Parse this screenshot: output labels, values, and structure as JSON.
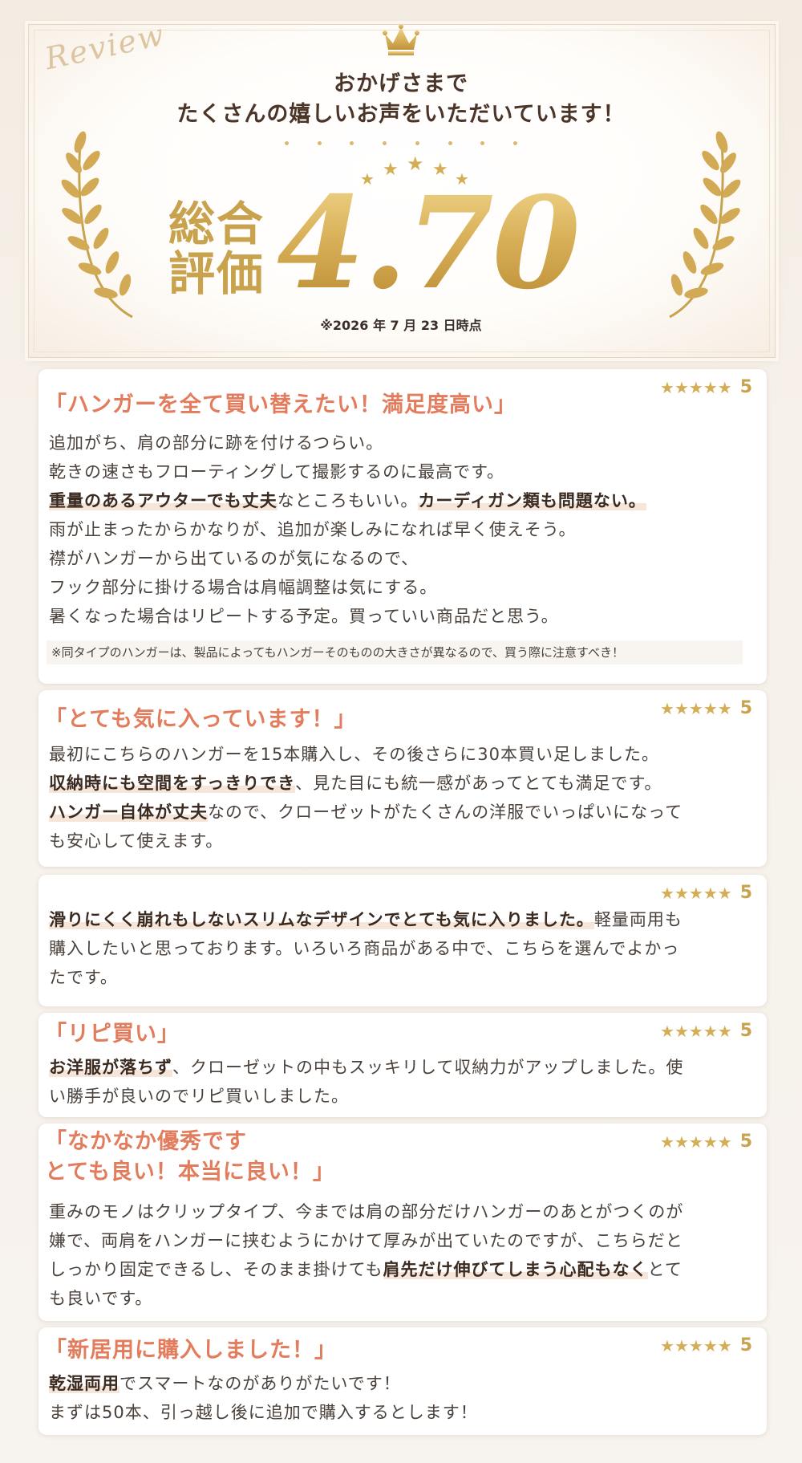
{
  "hero": {
    "script_word": "Review",
    "headline_line1": "おかげさまで",
    "headline_line2": "たくさんの嬉しいお声をいただいています！",
    "label_line1": "総合",
    "label_line2": "評価",
    "score": "4.70",
    "as_of": "※2026 年 7 月 23 日時点",
    "icons": [
      "crown-icon",
      "laurel-left-icon",
      "laurel-right-icon",
      "star-arc-icon"
    ],
    "gold_color": "#c9a24e"
  },
  "reviews": [
    {
      "stars": "★★★★★",
      "rating": "5",
      "title": "「ハンガーを全て買い替えたい！満足度高い」",
      "lines": [
        {
          "segs": [
            {
              "t": "追加がち、肩の部分に跡を付けるつらい。",
              "b": false
            }
          ]
        },
        {
          "segs": [
            {
              "t": "乾きの速さもフローティングして撮影するのに最高です。",
              "b": false
            }
          ]
        },
        {
          "segs": [
            {
              "t": "重量のあるアウターでも丈夫",
              "b": true
            },
            {
              "t": "なところもいい。",
              "b": false
            },
            {
              "t": "カーディガン類も問題ない。",
              "b": true
            }
          ]
        },
        {
          "segs": [
            {
              "t": "雨が止まったからかなりが、追加が楽しみになれば早く使えそう。",
              "b": false
            }
          ]
        },
        {
          "segs": [
            {
              "t": "襟がハンガーから出ているのが気になるので、",
              "b": false
            }
          ]
        },
        {
          "segs": [
            {
              "t": "フック部分に掛ける場合は肩幅調整は気にする。",
              "b": false
            }
          ]
        },
        {
          "segs": [
            {
              "t": "暑くなった場合はリピートする予定。買っていい商品だと思う。",
              "b": false
            }
          ]
        }
      ],
      "note": "※同タイプのハンガーは、製品によってもハンガーそのものの大きさが異なるので、買う際に注意すべき！"
    },
    {
      "stars": "★★★★★",
      "rating": "5",
      "title": "「とても気に入っています！」",
      "lines": [
        {
          "segs": [
            {
              "t": "最初にこちらのハンガーを15本購入し、その後さらに30本買い足しました。",
              "b": false
            }
          ]
        },
        {
          "segs": [
            {
              "t": "収納時にも空間をすっきりでき",
              "b": true
            },
            {
              "t": "、見た目にも統一感があってとても満足です。",
              "b": false
            }
          ]
        },
        {
          "segs": [
            {
              "t": "ハンガー自体が丈夫",
              "b": true
            },
            {
              "t": "なので、クローゼットがたくさんの洋服でいっぱいになって",
              "b": false
            }
          ]
        },
        {
          "segs": [
            {
              "t": "も安心して使えます。",
              "b": false
            }
          ]
        }
      ]
    },
    {
      "stars": "★★★★★",
      "rating": "5",
      "title": "",
      "lines": [
        {
          "segs": [
            {
              "t": "滑りにくく崩れもしないスリムなデザインでとても気に入りました。",
              "b": true
            },
            {
              "t": "軽量両用も",
              "b": false
            }
          ]
        },
        {
          "segs": [
            {
              "t": "購入したいと思っております。いろいろ商品がある中で、こちらを選んでよかっ",
              "b": false
            }
          ]
        },
        {
          "segs": [
            {
              "t": "たです。",
              "b": false
            }
          ]
        }
      ]
    },
    {
      "stars": "★★★★★",
      "rating": "5",
      "title": "「リピ買い」",
      "lines": [
        {
          "segs": [
            {
              "t": "お洋服が落ちず",
              "b": true
            },
            {
              "t": "、クローゼットの中もスッキリして収納力がアップしました。使",
              "b": false
            }
          ]
        },
        {
          "segs": [
            {
              "t": "い勝手が良いのでリピ買いしました。",
              "b": false
            }
          ]
        }
      ]
    },
    {
      "stars": "★★★★★",
      "rating": "5",
      "title_line1": "「なかなか優秀です",
      "title_line2": "とても良い！本当に良い！」",
      "lines": [
        {
          "segs": [
            {
              "t": "重みのモノはクリップタイプ、今までは肩の部分だけハンガーのあとがつくのが",
              "b": false
            }
          ]
        },
        {
          "segs": [
            {
              "t": "嫌で、両肩をハンガーに挟むようにかけて厚みが出ていたのですが、こちらだと",
              "b": false
            }
          ]
        },
        {
          "segs": [
            {
              "t": "しっかり固定できるし、そのまま掛けても",
              "b": false
            },
            {
              "t": "肩先だけ伸びてしまう心配もなく",
              "b": true
            },
            {
              "t": "とて",
              "b": false
            }
          ]
        },
        {
          "segs": [
            {
              "t": "も良いです。",
              "b": false
            }
          ]
        }
      ]
    },
    {
      "stars": "★★★★★",
      "rating": "5",
      "title": "「新居用に購入しました！」",
      "lines": [
        {
          "segs": [
            {
              "t": "乾湿両用",
              "b": true
            },
            {
              "t": "でスマートなのがありがたいです！",
              "b": false
            }
          ]
        },
        {
          "segs": [
            {
              "t": "まずは50本、引っ越し後に追加で購入するとします！",
              "b": false
            }
          ]
        }
      ]
    }
  ]
}
